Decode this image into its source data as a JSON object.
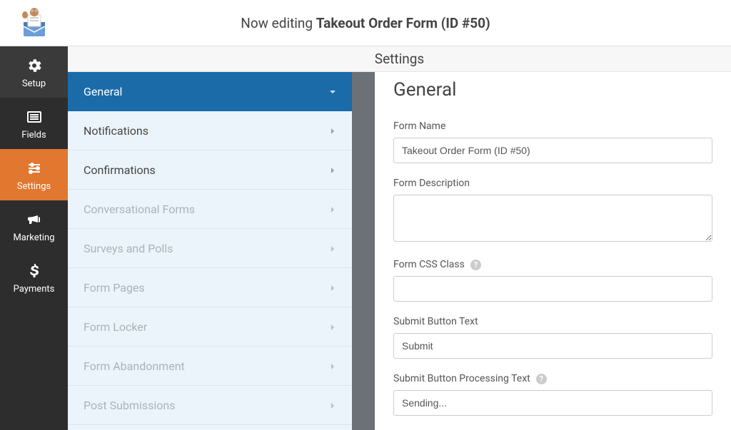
{
  "header": {
    "prefix": "Now editing ",
    "title_bold": "Takeout Order Form (ID #50)"
  },
  "sidebar": {
    "items": [
      {
        "label": "Setup"
      },
      {
        "label": "Fields"
      },
      {
        "label": "Settings"
      },
      {
        "label": "Marketing"
      },
      {
        "label": "Payments"
      }
    ]
  },
  "settings_bar": {
    "title": "Settings"
  },
  "panel": {
    "items": [
      {
        "label": "General",
        "active": true,
        "expanded": true
      },
      {
        "label": "Notifications"
      },
      {
        "label": "Confirmations"
      },
      {
        "label": "Conversational Forms",
        "dim": true
      },
      {
        "label": "Surveys and Polls",
        "dim": true
      },
      {
        "label": "Form Pages",
        "dim": true
      },
      {
        "label": "Form Locker",
        "dim": true
      },
      {
        "label": "Form Abandonment",
        "dim": true
      },
      {
        "label": "Post Submissions",
        "dim": true
      }
    ]
  },
  "main": {
    "heading": "General",
    "form_name": {
      "label": "Form Name",
      "value": "Takeout Order Form (ID #50)"
    },
    "form_description": {
      "label": "Form Description",
      "value": ""
    },
    "form_css_class": {
      "label": "Form CSS Class",
      "value": "",
      "help": true
    },
    "submit_text": {
      "label": "Submit Button Text",
      "value": "Submit"
    },
    "submit_processing": {
      "label": "Submit Button Processing Text",
      "value": "Sending...",
      "help": true
    }
  }
}
